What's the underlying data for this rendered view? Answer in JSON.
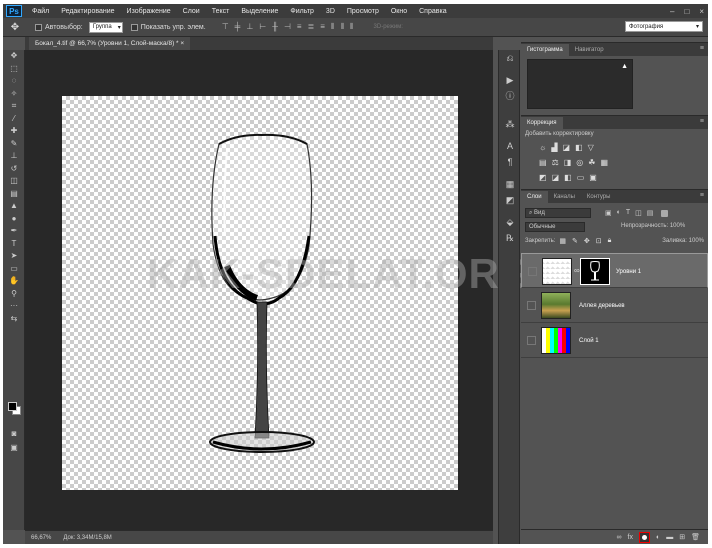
{
  "app": {
    "logo": "Ps"
  },
  "menu": [
    "Файл",
    "Редактирование",
    "Изображение",
    "Слои",
    "Текст",
    "Выделение",
    "Фильтр",
    "3D",
    "Просмотр",
    "Окно",
    "Справка"
  ],
  "window_controls": [
    "–",
    "□",
    "×"
  ],
  "options": {
    "autoselect_label": "Автовыбор:",
    "autoselect_value": "Группа",
    "show_controls_label": "Показать упр. элем.",
    "mode_3d": "3D-режим:",
    "workspace": "Фотография"
  },
  "document": {
    "tab_title": "Бокал_4.tif @ 66,7% (Уровни 1, Слой-маска/8) *",
    "tab_close": "×",
    "watermark": "KAK-SDELAT.ORG"
  },
  "statusbar": {
    "zoom": "66,67%",
    "doc_info": "Док: 3,34М/15,8М"
  },
  "panels": {
    "histogram_tabs": [
      "Гистограмма",
      "Навигатор"
    ],
    "correction_tab": "Коррекция",
    "correction_title": "Добавить корректировку",
    "layers_tabs": [
      "Слои",
      "Каналы",
      "Контуры"
    ],
    "filter_value": "Вид",
    "blend_mode": "Обычные",
    "opacity_label": "Непрозрачность:",
    "opacity_value": "100%",
    "lock_label": "Закрепить:",
    "fill_label": "Заливка:",
    "fill_value": "100%"
  },
  "layers": [
    {
      "name": "Уровни 1",
      "selected": true
    },
    {
      "name": "Аллея деревьев",
      "selected": false
    },
    {
      "name": "Слой 1",
      "selected": false
    }
  ],
  "colors": {
    "bg": "#535353",
    "dark": "#282828",
    "selected_layer": "#6a6a6a",
    "highlight": "#e00000"
  }
}
